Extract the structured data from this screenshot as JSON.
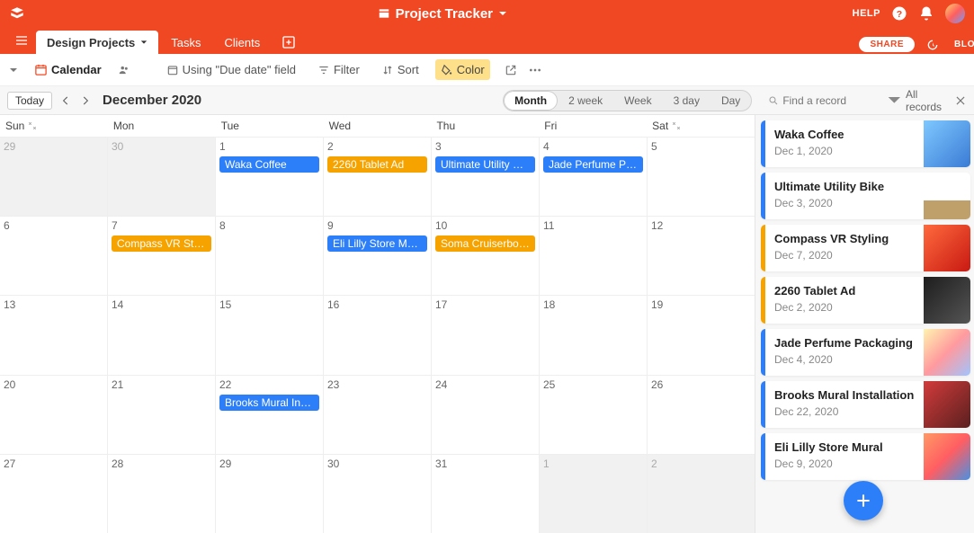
{
  "brand_color": "#f04823",
  "header": {
    "title": "Project Tracker",
    "help_label": "HELP"
  },
  "tabs": {
    "items": [
      {
        "label": "Design Projects",
        "active": true
      },
      {
        "label": "Tasks",
        "active": false
      },
      {
        "label": "Clients",
        "active": false
      }
    ],
    "share_label": "SHARE",
    "blocks_label": "BLOCKS"
  },
  "toolbar": {
    "view_name": "Calendar",
    "using_field": "Using \"Due date\" field",
    "filter_label": "Filter",
    "sort_label": "Sort",
    "color_label": "Color"
  },
  "viewbar": {
    "today_label": "Today",
    "month_label": "December 2020",
    "ranges": [
      "Month",
      "2 week",
      "Week",
      "3 day",
      "Day"
    ],
    "active_range": "Month",
    "find_placeholder": "Find a record",
    "all_records_label": "All records"
  },
  "calendar": {
    "dow": [
      "Sun",
      "Mon",
      "Tue",
      "Wed",
      "Thu",
      "Fri",
      "Sat"
    ],
    "weeks": [
      [
        {
          "n": "29",
          "out": true
        },
        {
          "n": "30",
          "out": true
        },
        {
          "n": "1",
          "events": [
            {
              "t": "Waka Coffee",
              "c": "blue"
            }
          ]
        },
        {
          "n": "2",
          "events": [
            {
              "t": "2260 Tablet Ad",
              "c": "orange"
            }
          ]
        },
        {
          "n": "3",
          "events": [
            {
              "t": "Ultimate Utility Bike",
              "c": "blue"
            }
          ]
        },
        {
          "n": "4",
          "events": [
            {
              "t": "Jade Perfume Pac…",
              "c": "blue"
            }
          ]
        },
        {
          "n": "5"
        }
      ],
      [
        {
          "n": "6"
        },
        {
          "n": "7",
          "events": [
            {
              "t": "Compass VR Styli…",
              "c": "orange"
            }
          ]
        },
        {
          "n": "8"
        },
        {
          "n": "9",
          "events": [
            {
              "t": "Eli Lilly Store Mural",
              "c": "blue"
            }
          ]
        },
        {
          "n": "10",
          "events": [
            {
              "t": "Soma Cruiserboard",
              "c": "orange"
            }
          ]
        },
        {
          "n": "11"
        },
        {
          "n": "12"
        }
      ],
      [
        {
          "n": "13"
        },
        {
          "n": "14"
        },
        {
          "n": "15"
        },
        {
          "n": "16"
        },
        {
          "n": "17"
        },
        {
          "n": "18"
        },
        {
          "n": "19"
        }
      ],
      [
        {
          "n": "20"
        },
        {
          "n": "21"
        },
        {
          "n": "22",
          "events": [
            {
              "t": "Brooks Mural Inst…",
              "c": "blue"
            }
          ]
        },
        {
          "n": "23"
        },
        {
          "n": "24"
        },
        {
          "n": "25"
        },
        {
          "n": "26"
        }
      ],
      [
        {
          "n": "27"
        },
        {
          "n": "28"
        },
        {
          "n": "29"
        },
        {
          "n": "30"
        },
        {
          "n": "31"
        },
        {
          "n": "1",
          "out": true
        },
        {
          "n": "2",
          "out": true
        }
      ]
    ]
  },
  "records": [
    {
      "title": "Waka Coffee",
      "date": "Dec 1, 2020",
      "stripe": "blue",
      "thumb": "a"
    },
    {
      "title": "Ultimate Utility Bike",
      "date": "Dec 3, 2020",
      "stripe": "blue",
      "thumb": "b"
    },
    {
      "title": "Compass VR Styling",
      "date": "Dec 7, 2020",
      "stripe": "orange",
      "thumb": "c"
    },
    {
      "title": "2260 Tablet Ad",
      "date": "Dec 2, 2020",
      "stripe": "orange",
      "thumb": "d"
    },
    {
      "title": "Jade Perfume Packaging",
      "date": "Dec 4, 2020",
      "stripe": "blue",
      "thumb": "e"
    },
    {
      "title": "Brooks Mural Installation",
      "date": "Dec 22, 2020",
      "stripe": "blue",
      "thumb": "f"
    },
    {
      "title": "Eli Lilly Store Mural",
      "date": "Dec 9, 2020",
      "stripe": "blue",
      "thumb": "g"
    }
  ]
}
